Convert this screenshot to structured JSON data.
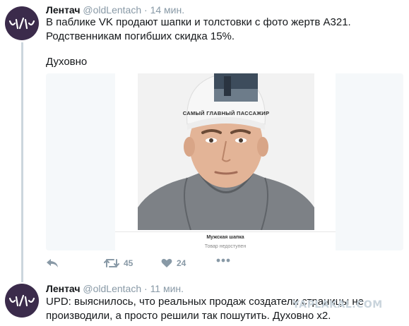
{
  "tweet1": {
    "name": "Лентач",
    "handle": "@oldLentach",
    "separator": "·",
    "time": "14 мин.",
    "line1": "В паблике VK продают шапки и толстовки с фото жертв А321.",
    "line2": "Родственникам погибших скидка 15%.",
    "line3": "Духовно",
    "card": {
      "hat_text": "САМЫЙ ГЛАВНЫЙ ПАССАЖИР",
      "product_title": "Мужская шапка",
      "product_status": "Товар недоступен"
    },
    "actions": {
      "retweets": "45",
      "likes": "24"
    }
  },
  "tweet2": {
    "name": "Лентач",
    "handle": "@oldLentach",
    "separator": "·",
    "time": "11 мин.",
    "line1": "UPD: выяснилось, что реальных продаж создатели страницы не",
    "line2": "производили, а просто решили так пошутить. Духовно x2."
  },
  "watermark": "YAPLAKAL.COM",
  "colors": {
    "avatar_bg": "#3b2b4b",
    "thread_line": "#ccd6dd",
    "muted_text": "#8899a6"
  },
  "icons": [
    "reply-icon",
    "retweet-icon",
    "like-icon",
    "more-icon",
    "avatar-logo-icon"
  ]
}
